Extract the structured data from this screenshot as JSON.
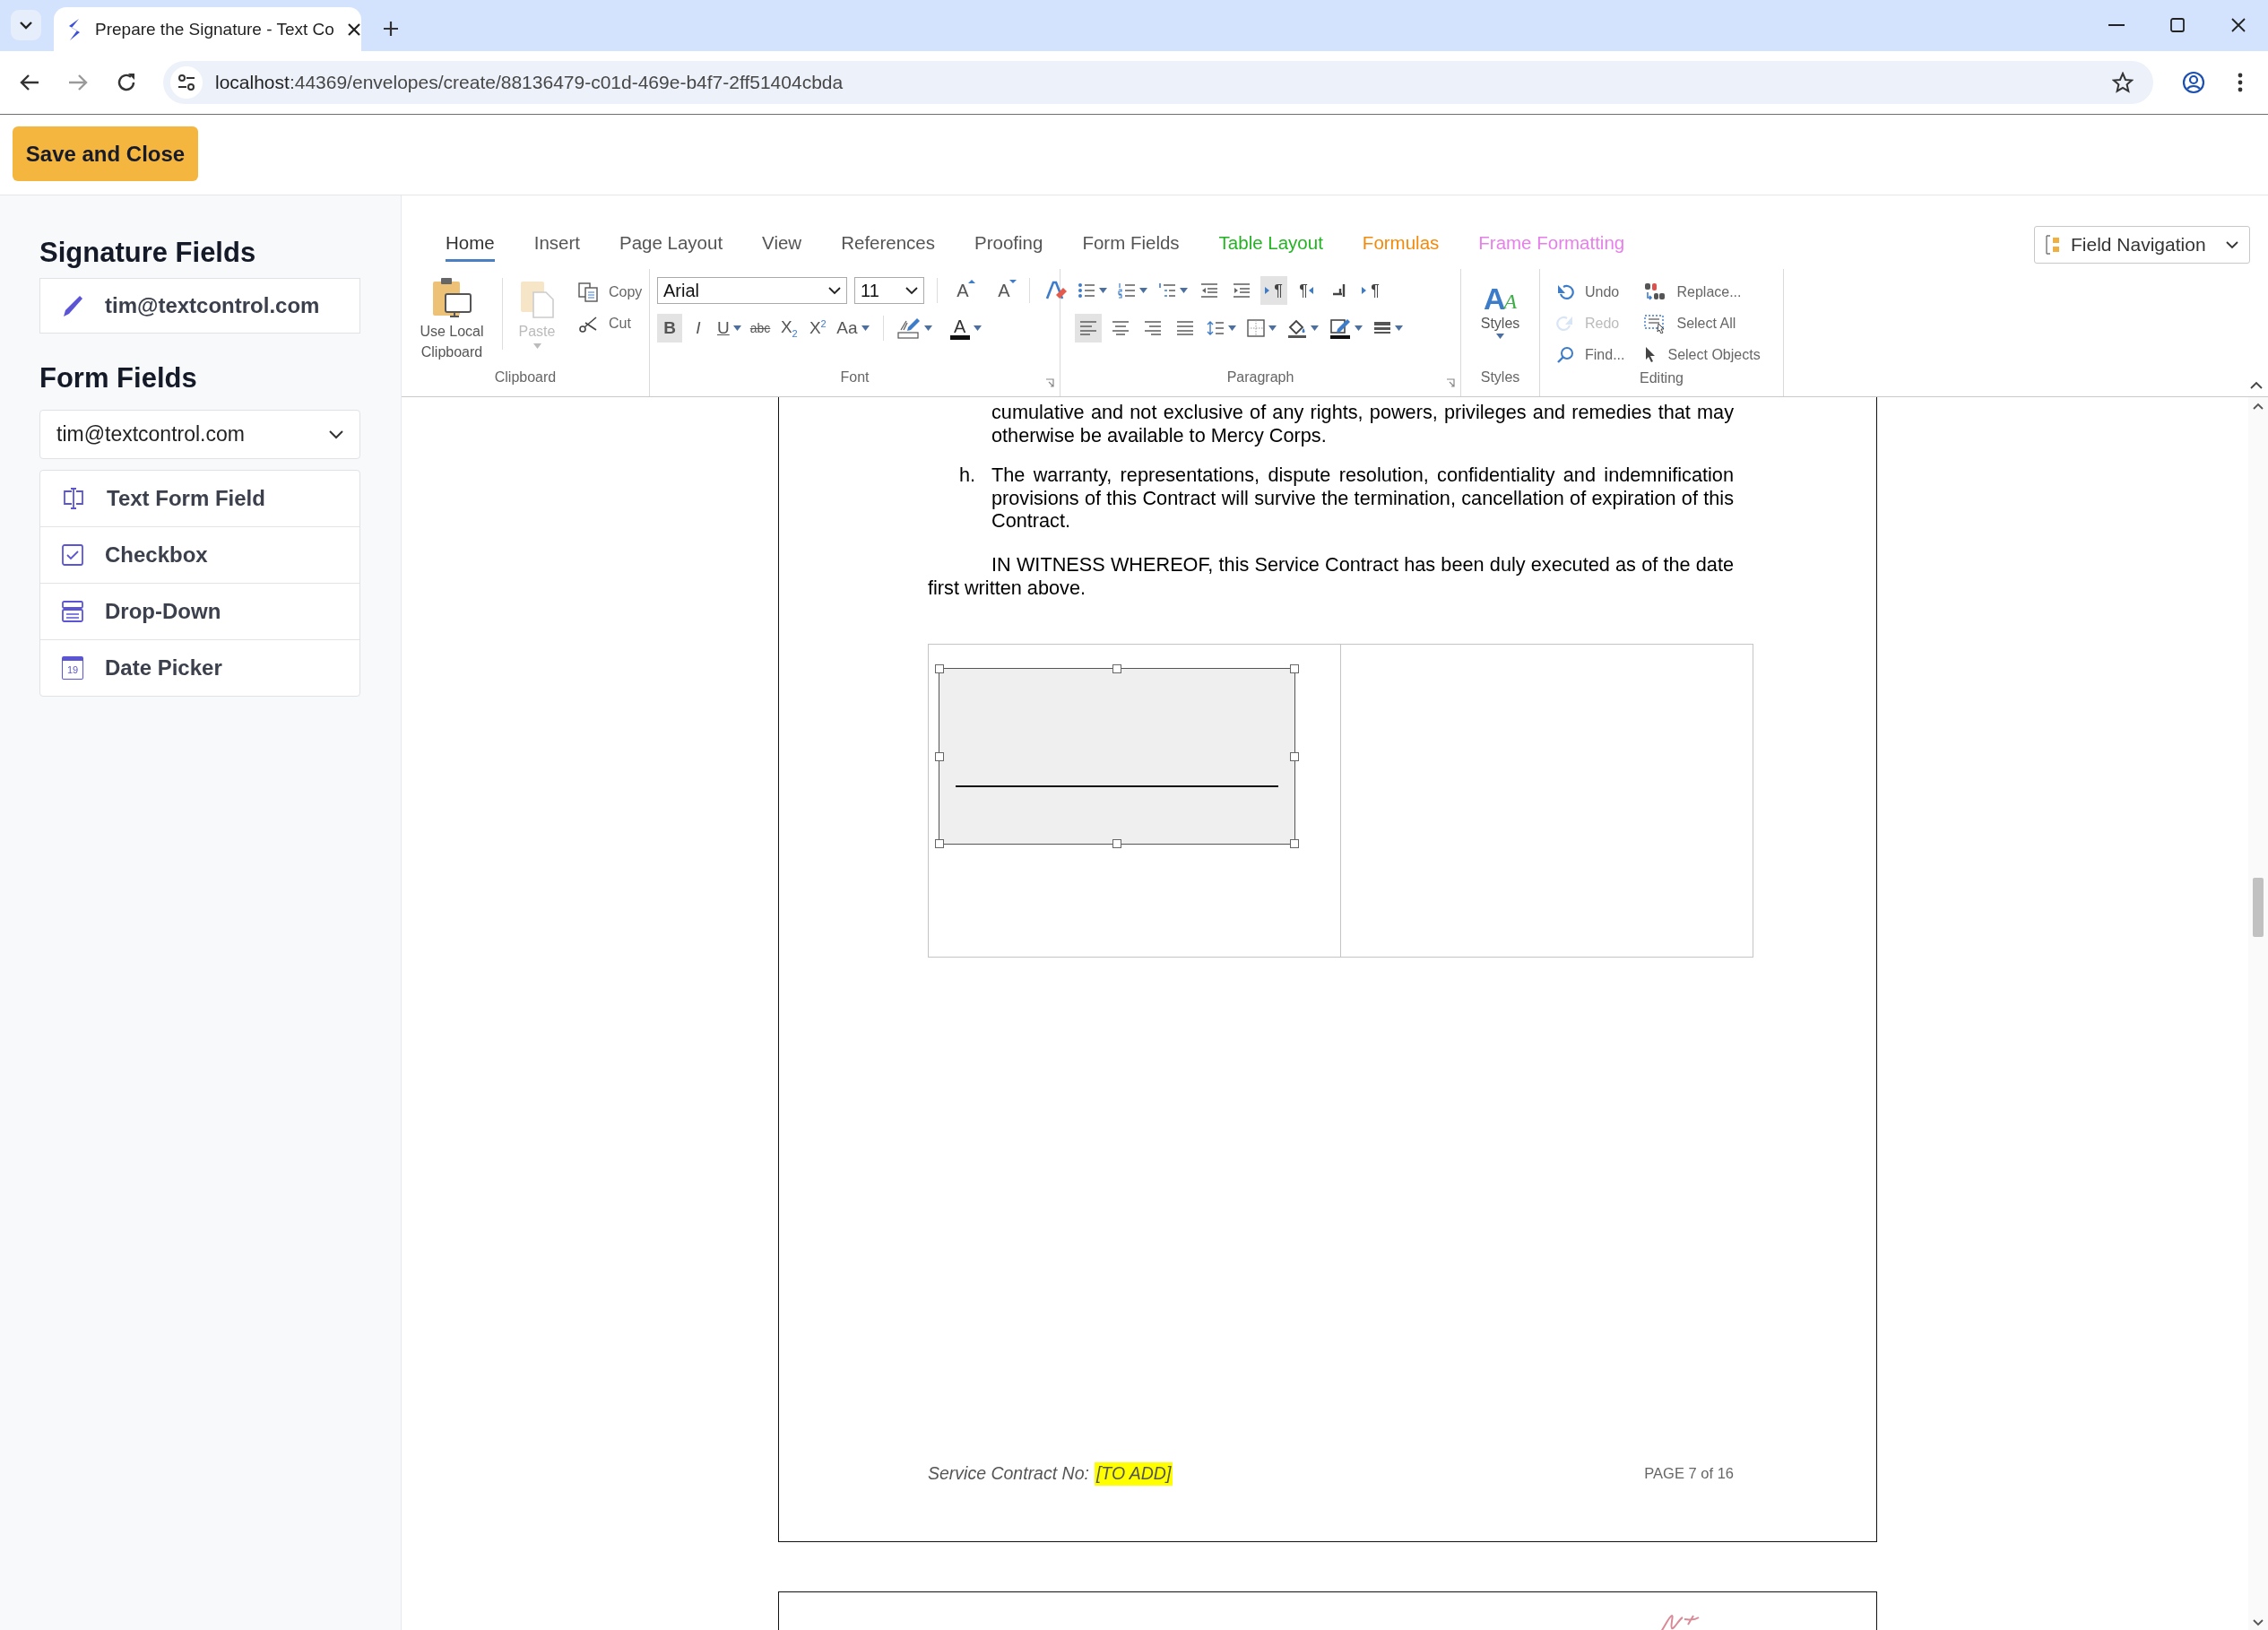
{
  "browser": {
    "tab_title": "Prepare the Signature - Text Co",
    "url_host": "localhost",
    "url_rest": ":44369/envelopes/create/88136479-c01d-469e-b4f7-2ff51404cbda"
  },
  "header": {
    "save_label": "Save and Close"
  },
  "sidebar": {
    "signature_heading": "Signature Fields",
    "signature_fields": [
      {
        "label": "tim@textcontrol.com"
      }
    ],
    "form_heading": "Form Fields",
    "signer": "tim@textcontrol.com",
    "form_fields": [
      {
        "kind": "text",
        "label": "Text Form Field"
      },
      {
        "kind": "checkbox",
        "label": "Checkbox"
      },
      {
        "kind": "dropdown",
        "label": "Drop-Down"
      },
      {
        "kind": "date",
        "label": "Date Picker",
        "day": "19"
      }
    ]
  },
  "ribbon": {
    "tabs": [
      {
        "label": "Home",
        "selected": true
      },
      {
        "label": "Insert",
        "selected": false
      },
      {
        "label": "Page Layout",
        "selected": false
      },
      {
        "label": "View",
        "selected": false
      },
      {
        "label": "References",
        "selected": false
      },
      {
        "label": "Proofing",
        "selected": false
      },
      {
        "label": "Form Fields",
        "selected": false
      },
      {
        "label": "Table Layout",
        "selected": false,
        "color": "#22b322"
      },
      {
        "label": "Formulas",
        "selected": false,
        "color": "#f28a0c"
      },
      {
        "label": "Frame Formatting",
        "selected": false,
        "color": "#e77fea"
      }
    ],
    "field_navigation": "Field Navigation",
    "clipboard": {
      "title": "Clipboard",
      "local": "Use Local Clipboard",
      "paste": {
        "label": "Paste",
        "disabled": true
      },
      "copy": "Copy",
      "cut": "Cut"
    },
    "font": {
      "title": "Font",
      "font_name": "Arial",
      "font_size": "11",
      "size_tools": [
        {
          "kind": "grow",
          "glyph": "A"
        },
        {
          "kind": "shrink",
          "glyph": "A"
        }
      ],
      "format_buttons": [
        {
          "kind": "bold",
          "label": "B",
          "selected": true,
          "dropdown": false
        },
        {
          "kind": "italic",
          "label": "I",
          "selected": false,
          "dropdown": false
        },
        {
          "kind": "underline",
          "label": "U",
          "selected": false,
          "dropdown": true
        },
        {
          "kind": "strike",
          "label": "abc",
          "selected": false,
          "dropdown": false
        },
        {
          "kind": "sub",
          "label": "X$_{2}$",
          "selected": false,
          "dropdown": false
        },
        {
          "kind": "sup",
          "label": "X$^{2}$",
          "selected": false,
          "dropdown": false
        },
        {
          "kind": "case",
          "label": "Aa",
          "selected": false,
          "dropdown": true
        }
      ],
      "font_color_glyph": "A"
    },
    "paragraph": {
      "title": "Paragraph",
      "row1": [
        {
          "kind": "bullets",
          "selected": false,
          "dropdown": true
        },
        {
          "kind": "numbering",
          "selected": false,
          "dropdown": true
        },
        {
          "kind": "multilevel",
          "selected": false,
          "dropdown": true
        },
        {
          "kind": "outdent",
          "selected": false,
          "dropdown": false
        },
        {
          "kind": "indent",
          "selected": false,
          "dropdown": false
        },
        {
          "kind": "ltr",
          "glyph": "¶",
          "selected": true,
          "dropdown": false
        },
        {
          "kind": "rtl",
          "glyph": "¶",
          "selected": false,
          "dropdown": false
        },
        {
          "kind": "frame",
          "selected": false,
          "dropdown": false
        },
        {
          "kind": "marks",
          "glyph": "¶",
          "selected": false,
          "dropdown": false
        }
      ],
      "row2": [
        {
          "kind": "align_left",
          "selected": true,
          "dropdown": false
        },
        {
          "kind": "align_center",
          "selected": false,
          "dropdown": false
        },
        {
          "kind": "align_right",
          "selected": false,
          "dropdown": false
        },
        {
          "kind": "justify",
          "selected": false,
          "dropdown": false
        },
        {
          "kind": "spacing",
          "selected": false,
          "dropdown": true
        },
        {
          "kind": "borders",
          "selected": false,
          "dropdown": true
        },
        {
          "kind": "shading",
          "selected": false,
          "dropdown": true
        },
        {
          "kind": "frame_color",
          "selected": false,
          "dropdown": true
        },
        {
          "kind": "border_style",
          "selected": false,
          "dropdown": true
        }
      ]
    },
    "styles": {
      "title": "Styles",
      "label": "Styles",
      "glyphs": [
        "A",
        "A"
      ]
    },
    "editing": {
      "title": "Editing",
      "items": [
        {
          "kind": "undo",
          "label": "Undo",
          "disabled": false
        },
        {
          "kind": "redo",
          "label": "Redo",
          "disabled": true
        },
        {
          "kind": "find",
          "label": "Find...",
          "disabled": false
        },
        {
          "kind": "replace",
          "label": "Replace...",
          "disabled": false
        },
        {
          "kind": "select_all",
          "label": "Select All",
          "disabled": false
        },
        {
          "kind": "select_objects",
          "label": "Select Objects",
          "disabled": false
        }
      ]
    }
  },
  "document": {
    "paragraphs": [
      {
        "kind": "continuation",
        "text": "cumulative and not exclusive of any rights, powers, privileges and remedies that may otherwise be available to Mercy Corps."
      },
      {
        "kind": "list_item",
        "marker": "h.",
        "text": "The warranty, representations, dispute resolution, confidentiality and indemnification provisions of this Contract will survive the termination, cancellation of expiration of this Contract."
      },
      {
        "kind": "body",
        "text": "IN WITNESS WHEREOF, this Service Contract has been duly executed as of the date first written above."
      }
    ],
    "footer": {
      "label": "Service Contract No:",
      "placeholder": "[TO ADD]",
      "page": "PAGE 7 of 16"
    }
  }
}
